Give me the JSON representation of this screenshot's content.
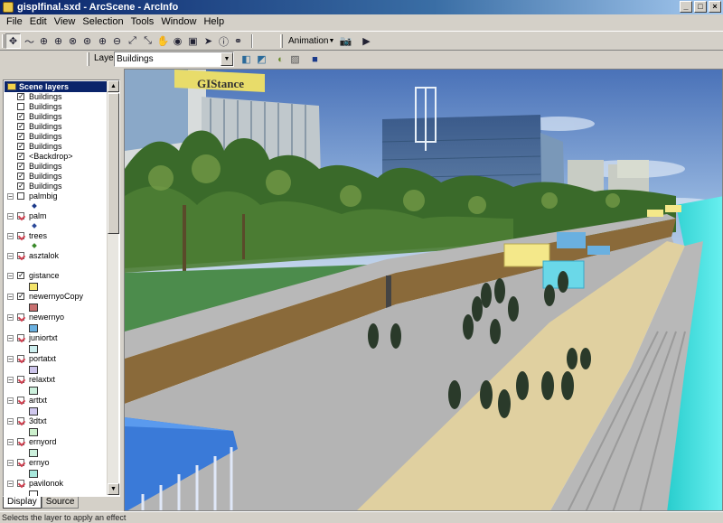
{
  "window": {
    "title": "gisplfinal.sxd - ArcScene - ArcInfo"
  },
  "menu": [
    "File",
    "Edit",
    "View",
    "Selection",
    "Tools",
    "Window",
    "Help"
  ],
  "toolbar": {
    "animation_label": "Animation"
  },
  "layer_toolbar": {
    "label": "Layer:",
    "selected": "Buildings"
  },
  "toc": {
    "header": "Scene layers",
    "layers": [
      {
        "name": "Buildings",
        "checked": true
      },
      {
        "name": "Buildings",
        "checked": false
      },
      {
        "name": "Buildings",
        "checked": true
      },
      {
        "name": "Buildings",
        "checked": true
      },
      {
        "name": "Buildings",
        "checked": true
      },
      {
        "name": "Buildings",
        "checked": true
      },
      {
        "name": "<Backdrop>",
        "checked": true
      },
      {
        "name": "Buildings",
        "checked": true
      },
      {
        "name": "Buildings",
        "checked": true
      },
      {
        "name": "Buildings",
        "checked": true
      },
      {
        "name": "palmbig",
        "checked": false,
        "symbol": "diamond",
        "color": "#1c3a8a"
      },
      {
        "name": "palm",
        "checked": "red",
        "symbol": "diamond",
        "color": "#2c4a9a"
      },
      {
        "name": "trees",
        "checked": "red",
        "symbol": "diamond",
        "color": "#3a8a2a"
      },
      {
        "name": "asztalok",
        "checked": "red",
        "symbol": "none"
      },
      {
        "name": "gistance",
        "checked": true,
        "symbol": "swatch",
        "color": "#f4e46a"
      },
      {
        "name": "newernyoCopy",
        "checked": true,
        "symbol": "swatch",
        "color": "#c87070"
      },
      {
        "name": "newernyo",
        "checked": "red",
        "symbol": "swatch",
        "color": "#6ab0e0"
      },
      {
        "name": "juniortxt",
        "checked": "red",
        "symbol": "swatch",
        "color": "#cceeee"
      },
      {
        "name": "portatxt",
        "checked": "red",
        "symbol": "swatch",
        "color": "#ccc4ea"
      },
      {
        "name": "relaxtxt",
        "checked": "red",
        "symbol": "swatch",
        "color": "#ccf0dc"
      },
      {
        "name": "arttxt",
        "checked": "red",
        "symbol": "swatch",
        "color": "#d0c8ee"
      },
      {
        "name": "3dtxt",
        "checked": "red",
        "symbol": "swatch",
        "color": "#ccf0cc"
      },
      {
        "name": "ernyord",
        "checked": "red",
        "symbol": "swatch",
        "color": "#ccf0dc"
      },
      {
        "name": "ernyo",
        "checked": "red",
        "symbol": "swatch",
        "color": "#a8e8dc"
      },
      {
        "name": "pavilonok",
        "checked": "red",
        "symbol": "swatch",
        "color": "#ffffff"
      }
    ]
  },
  "tabs": [
    "Display",
    "Source"
  ],
  "scene": {
    "building_sign": "GIStance"
  },
  "status": "Selects the layer to apply an effect"
}
